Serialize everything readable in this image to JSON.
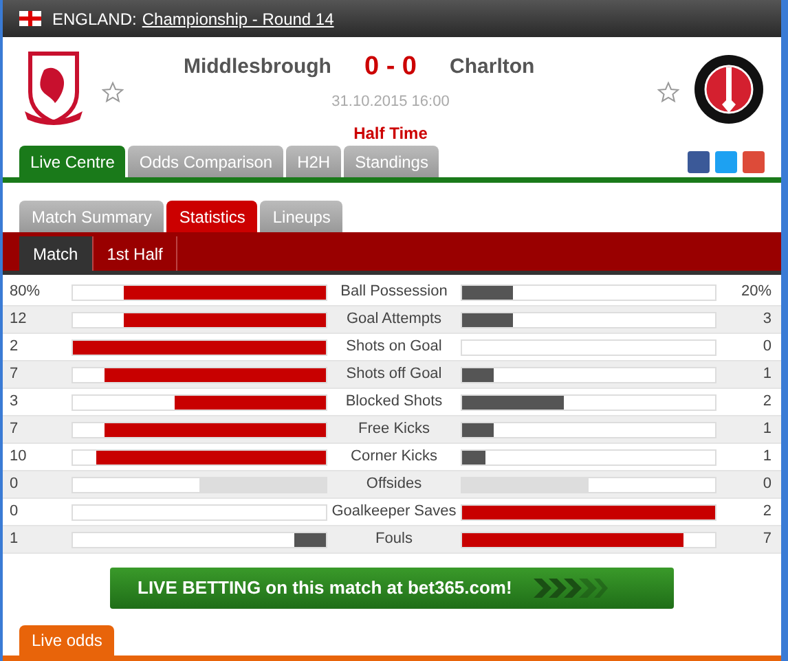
{
  "header": {
    "country": "ENGLAND:",
    "competition": "Championship - Round 14"
  },
  "match": {
    "home": "Middlesbrough",
    "score": "0 - 0",
    "away": "Charlton",
    "datetime": "31.10.2015 16:00",
    "status": "Half Time",
    "home_favourite": false,
    "away_favourite": false
  },
  "main_tabs": [
    {
      "label": "Live Centre",
      "selected": true
    },
    {
      "label": "Odds Comparison",
      "selected": false
    },
    {
      "label": "H2H",
      "selected": false
    },
    {
      "label": "Standings",
      "selected": false
    }
  ],
  "sub_tabs": [
    {
      "label": "Match Summary",
      "selected": false
    },
    {
      "label": "Statistics",
      "selected": true
    },
    {
      "label": "Lineups",
      "selected": false
    }
  ],
  "period_tabs": [
    {
      "label": "Match",
      "selected": true
    },
    {
      "label": "1st Half",
      "selected": false
    }
  ],
  "stats": [
    {
      "label": "Ball Possession",
      "kind": "home",
      "home": {
        "value": "80%",
        "level": 0.8
      },
      "away": {
        "value": "20%",
        "level": 0.2
      }
    },
    {
      "label": "Goal Attempts",
      "kind": "home",
      "home": {
        "value": "12",
        "level": 0.8
      },
      "away": {
        "value": "3",
        "level": 0.2
      }
    },
    {
      "label": "Shots on Goal",
      "kind": "home",
      "home": {
        "value": "2",
        "level": 1
      },
      "away": {
        "value": "0",
        "level": 0
      }
    },
    {
      "label": "Shots off Goal",
      "kind": "home",
      "home": {
        "value": "7",
        "level": 0.875
      },
      "away": {
        "value": "1",
        "level": 0.125
      }
    },
    {
      "label": "Blocked Shots",
      "kind": "home",
      "home": {
        "value": "3",
        "level": 0.6
      },
      "away": {
        "value": "2",
        "level": 0.4
      }
    },
    {
      "label": "Free Kicks",
      "kind": "home",
      "home": {
        "value": "7",
        "level": 0.875
      },
      "away": {
        "value": "1",
        "level": 0.125
      }
    },
    {
      "label": "Corner Kicks",
      "kind": "home",
      "home": {
        "value": "10",
        "level": 0.91
      },
      "away": {
        "value": "1",
        "level": 0.09
      }
    },
    {
      "label": "Offsides",
      "kind": "even",
      "home": {
        "value": "0",
        "level": 0.5
      },
      "away": {
        "value": "0",
        "level": 0.5
      }
    },
    {
      "label": "Goalkeeper Saves",
      "kind": "away",
      "home": {
        "value": "0",
        "level": 0
      },
      "away": {
        "value": "2",
        "level": 1
      }
    },
    {
      "label": "Fouls",
      "kind": "away",
      "home": {
        "value": "1",
        "level": 0.125
      },
      "away": {
        "value": "7",
        "level": 0.875
      }
    }
  ],
  "banner": "LIVE BETTING on this match at bet365.com!",
  "bottom_tab": {
    "label": "Live odds",
    "selected": true
  }
}
